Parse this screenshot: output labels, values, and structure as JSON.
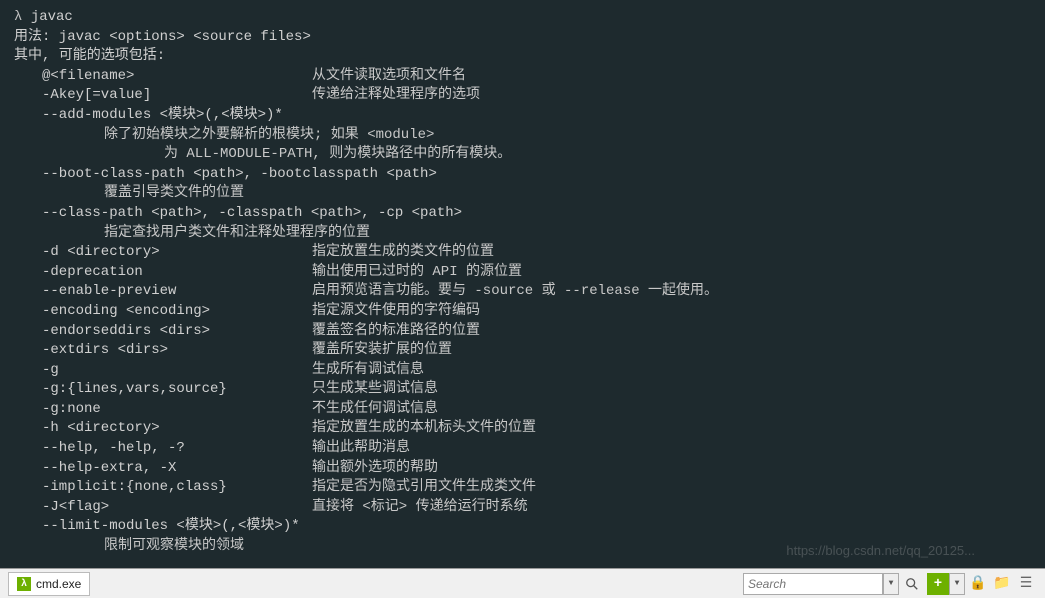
{
  "prompt": "λ ",
  "command": "javac",
  "usage_line": "用法: javac <options> <source files>",
  "header_line": "其中, 可能的选项包括:",
  "options": [
    {
      "flag": "@<filename>",
      "desc": "从文件读取选项和文件名",
      "style": "simple"
    },
    {
      "flag": "-Akey[=value]",
      "desc": "传递给注释处理程序的选项",
      "style": "simple"
    },
    {
      "flag": "--add-modules <模块>(,<模块>)*",
      "desc": "",
      "style": "flagonly"
    },
    {
      "flag": "",
      "desc": "除了初始模块之外要解析的根模块; 如果 <module>",
      "style": "descindent3"
    },
    {
      "flag": "",
      "desc": "为 ALL-MODULE-PATH, 则为模块路径中的所有模块。",
      "style": "descindent4"
    },
    {
      "flag": "--boot-class-path <path>, -bootclasspath <path>",
      "desc": "",
      "style": "flagonly"
    },
    {
      "flag": "",
      "desc": "覆盖引导类文件的位置",
      "style": "descindent3"
    },
    {
      "flag": "--class-path <path>, -classpath <path>, -cp <path>",
      "desc": "",
      "style": "flagonly"
    },
    {
      "flag": "",
      "desc": "指定查找用户类文件和注释处理程序的位置",
      "style": "descindent3"
    },
    {
      "flag": "-d <directory>",
      "desc": "指定放置生成的类文件的位置",
      "style": "simple"
    },
    {
      "flag": "-deprecation",
      "desc": "输出使用已过时的 API 的源位置",
      "style": "simple"
    },
    {
      "flag": "--enable-preview",
      "desc": "启用预览语言功能。要与 -source 或 --release 一起使用。",
      "style": "simple"
    },
    {
      "flag": "-encoding <encoding>",
      "desc": "指定源文件使用的字符编码",
      "style": "simple"
    },
    {
      "flag": "-endorseddirs <dirs>",
      "desc": "覆盖签名的标准路径的位置",
      "style": "simple"
    },
    {
      "flag": "-extdirs <dirs>",
      "desc": "覆盖所安装扩展的位置",
      "style": "simple"
    },
    {
      "flag": "-g",
      "desc": "生成所有调试信息",
      "style": "simple"
    },
    {
      "flag": "-g:{lines,vars,source}",
      "desc": "只生成某些调试信息",
      "style": "simple"
    },
    {
      "flag": "-g:none",
      "desc": "不生成任何调试信息",
      "style": "simple"
    },
    {
      "flag": "-h <directory>",
      "desc": "指定放置生成的本机标头文件的位置",
      "style": "simple"
    },
    {
      "flag": "--help, -help, -?",
      "desc": "输出此帮助消息",
      "style": "simple"
    },
    {
      "flag": "--help-extra, -X",
      "desc": "输出额外选项的帮助",
      "style": "simple"
    },
    {
      "flag": "-implicit:{none,class}",
      "desc": "指定是否为隐式引用文件生成类文件",
      "style": "simple"
    },
    {
      "flag": "-J<flag>",
      "desc": "直接将 <标记> 传递给运行时系统",
      "style": "simple"
    },
    {
      "flag": "--limit-modules <模块>(,<模块>)*",
      "desc": "",
      "style": "flagonly"
    },
    {
      "flag": "",
      "desc": "限制可观察模块的领域",
      "style": "descindent3"
    }
  ],
  "taskbar": {
    "tab_icon": "λ",
    "tab_label": "cmd.exe",
    "search_placeholder": "Search",
    "plus": "+"
  },
  "watermark": "https://blog.csdn.net/qq_20125..."
}
